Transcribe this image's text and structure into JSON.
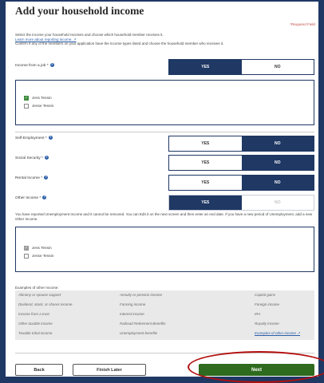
{
  "page": {
    "title": "Add your household income",
    "required_note": "*Required Field",
    "intro_line1": "Select the income your household receives and choose which household member receives it.",
    "intro_link": "Learn more about reporting income. ↗",
    "intro_line2": "Confirm if any of the members on your application have the income types listed and choose the household member who receives it."
  },
  "questions": {
    "job": {
      "label": "Income from a job *",
      "selected": "YES",
      "yes": "YES",
      "no": "NO"
    },
    "self": {
      "label": "Self-Employment *",
      "selected": "NO",
      "yes": "YES",
      "no": "NO"
    },
    "ss": {
      "label": "Social Security *",
      "selected": "NO",
      "yes": "YES",
      "no": "NO"
    },
    "rental": {
      "label": "Rental Income *",
      "selected": "NO",
      "yes": "YES",
      "no": "NO"
    },
    "other": {
      "label": "Other Income *",
      "selected": "YES",
      "yes": "YES",
      "no": "NO"
    }
  },
  "job_members": [
    {
      "name": "Jess Tessin",
      "checked": true
    },
    {
      "name": "Jesse Tessin",
      "checked": false
    }
  ],
  "other_members": [
    {
      "name": "Jess Tessin",
      "checked": true
    },
    {
      "name": "Jesse Tessin",
      "checked": false
    }
  ],
  "unemployment_note": "You have reported Unemployment Income and it cannot be removed. You can Edit it on the next screen and then enter an end date. If you have a new period of Unemployment, add a new Other Income.",
  "examples": {
    "label": "Examples of other Income:",
    "col1": [
      "Alimony or spouse support",
      "Dividend, stock, or shares income",
      "Income from a trust",
      "Other taxable income",
      "Taxable tribal income"
    ],
    "col2": [
      "Annuity or pension income",
      "Farming income",
      "Interest income",
      "Railroad Retirement Benefits",
      "Unemployment benefits"
    ],
    "col3": [
      "Capital gains",
      "Foreign income",
      "IRA",
      "Royalty income"
    ],
    "more_link": "Examples of other income ↗"
  },
  "buttons": {
    "back": "Back",
    "finish_later": "Finish Later",
    "next": "Next"
  },
  "colors": {
    "navy": "#1f3864",
    "green": "#2e6b1f",
    "annotation_red": "#b30f0f"
  }
}
